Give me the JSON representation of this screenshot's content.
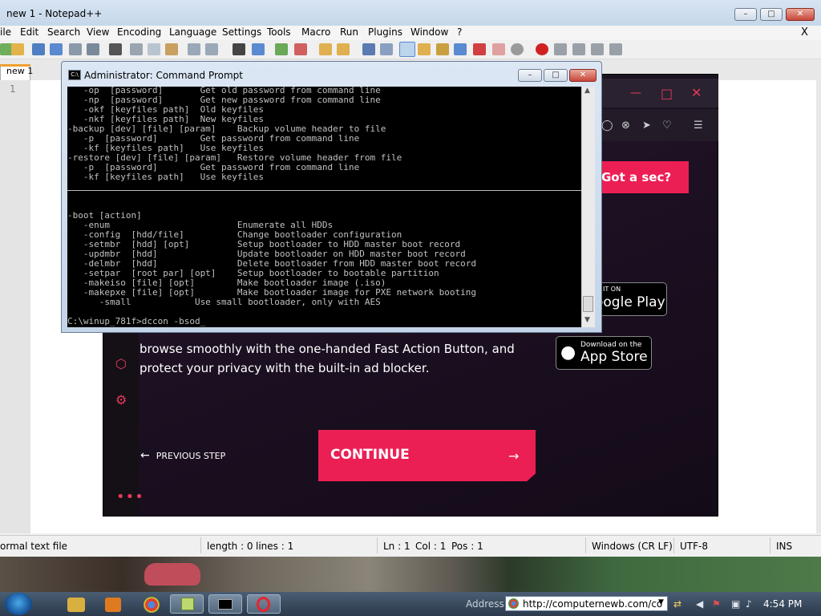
{
  "notepad": {
    "title": "new 1 - Notepad++",
    "menu": [
      "ile",
      "Edit",
      "Search",
      "View",
      "Encoding",
      "Language",
      "Settings",
      "Tools",
      "Macro",
      "Run",
      "Plugins",
      "Window",
      "?"
    ],
    "close_x": "X",
    "tab": "new 1",
    "line_number": "1",
    "status": {
      "file_type": "ormal text file",
      "length": "length : 0",
      "lines": "lines : 1",
      "ln": "Ln : 1",
      "col": "Col : 1",
      "pos": "Pos : 1",
      "eol": "Windows (CR LF)",
      "encoding": "UTF-8",
      "mode": "INS"
    }
  },
  "cmd": {
    "title": "Administrator: Command Prompt",
    "icon_label": "C:\\",
    "lines_top": [
      "   -op  [password]       Get old password from command line",
      "   -np  [password]       Get new password from command line",
      "   -okf [keyfiles path]  Old keyfiles",
      "   -nkf [keyfiles path]  New keyfiles",
      "-backup [dev] [file] [param]    Backup volume header to file",
      "   -p  [password]        Get password from command line",
      "   -kf [keyfiles path]   Use keyfiles",
      "-restore [dev] [file] [param]   Restore volume header from file",
      "   -p  [password]        Get password from command line",
      "   -kf [keyfiles path]   Use keyfiles"
    ],
    "lines_bottom": [
      "-boot [action]",
      "   -enum                        Enumerate all HDDs",
      "   -config  [hdd/file]          Change bootloader configuration",
      "   -setmbr  [hdd] [opt]         Setup bootloader to HDD master boot record",
      "   -updmbr  [hdd]               Update bootloader on HDD master boot record",
      "   -delmbr  [hdd]               Delete bootloader from HDD master boot record",
      "   -setpar  [root par] [opt]    Setup bootloader to bootable partition",
      "   -makeiso [file] [opt]        Make bootloader image (.iso)",
      "   -makepxe [file] [opt]        Make bootloader image for PXE network booting",
      "      -small            Use small bootloader, only with AES"
    ],
    "prompt": "C:\\winup_781f>dccon -bsod_"
  },
  "browser": {
    "got_a_sec": "Got a sec?",
    "google_play_small": "IT ON",
    "google_play_big": "oogle Play",
    "app_store_small": "Download on the",
    "app_store_big": "App Store",
    "promo_line1": "browse smoothly with the one-handed Fast Action Button, and",
    "promo_line2": "protect your privacy with the built-in ad blocker.",
    "previous_step": "PREVIOUS STEP",
    "continue": "CONTINUE",
    "accent_color": "#ec1f55"
  },
  "taskbar": {
    "address_label": "Address",
    "address_url": "http://computernewb.com/co",
    "clock": "4:54 PM"
  }
}
